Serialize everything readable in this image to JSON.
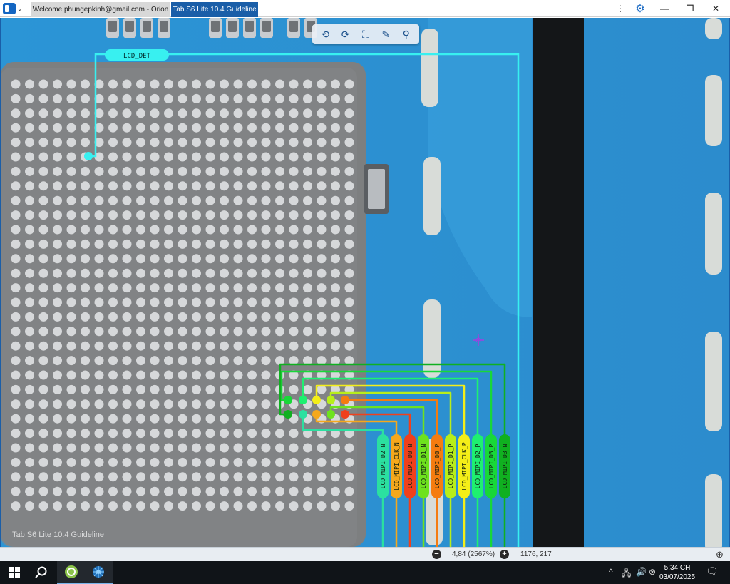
{
  "window": {
    "tabs": [
      {
        "label": "Welcome phungepkinh@gmail.com - Orion",
        "active": false
      },
      {
        "label": "Tab S6 Lite 10.4 Guideline",
        "active": true
      }
    ],
    "controls": {
      "more": "⋮",
      "settings": "⚙",
      "minimize": "—",
      "restore": "❐",
      "close": "✕"
    }
  },
  "toolbar": {
    "tools": [
      "rotate-left-icon",
      "rotate-right-icon",
      "fit-screen-icon",
      "brush-icon",
      "search-icon"
    ]
  },
  "board": {
    "watermark": "Tab S6 Lite 10.4 Guideline",
    "lcd_det_label": "LCD_DET",
    "nets": [
      {
        "label": "LCD_MIPI_D2_N",
        "color": "#2be0a0"
      },
      {
        "label": "LCD_MIPI_CLK_N",
        "color": "#f5a81c"
      },
      {
        "label": "LCD_MIPI_D0_N",
        "color": "#f0401c"
      },
      {
        "label": "LCD_MIPI_D1_N",
        "color": "#6ee21e"
      },
      {
        "label": "LCD_MIPI_D0_P",
        "color": "#f57c10"
      },
      {
        "label": "LCD_MIPI_D1_P",
        "color": "#b8ee1a"
      },
      {
        "label": "LCD_MIPI_CLK_P",
        "color": "#f4ee18"
      },
      {
        "label": "LCD_MIPI_D2_P",
        "color": "#1ef070"
      },
      {
        "label": "LCD_MIPI_D3_P",
        "color": "#18d838"
      },
      {
        "label": "LCD_MIPI_D3_N",
        "color": "#10b020"
      }
    ],
    "colors": {
      "trace_cyan": "#38f0f0",
      "board_blue": "#2a8fd0",
      "chip_gray": "#7d7f80"
    }
  },
  "status": {
    "zoom_out": "−",
    "zoom": "4,84 (2567%)",
    "zoom_in": "+",
    "coords": "1176, 217"
  },
  "taskbar": {
    "time": "5:34 CH",
    "date": "03/07/2025"
  }
}
